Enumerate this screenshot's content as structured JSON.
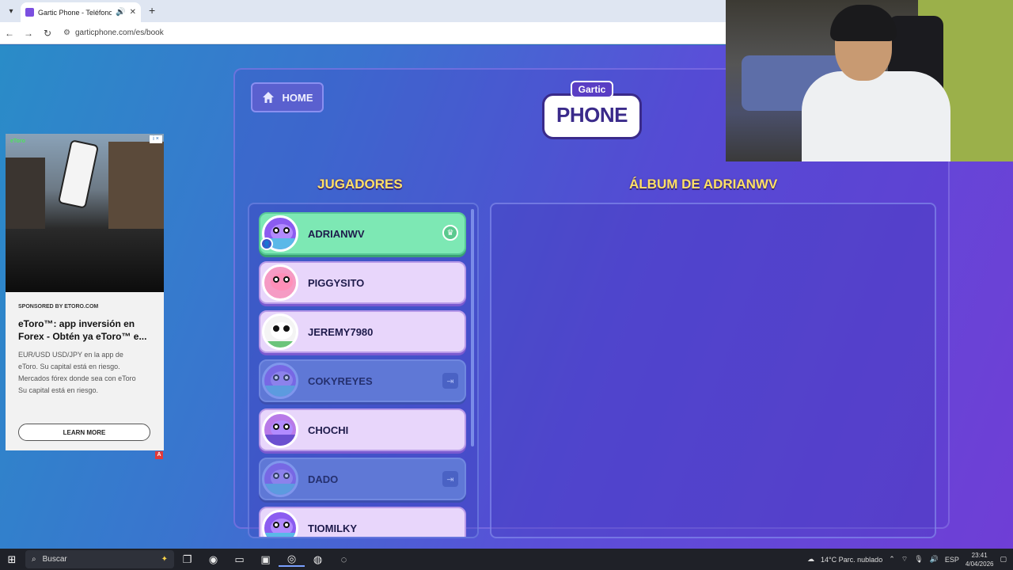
{
  "browser": {
    "tab_title": "Gartic Phone - Teléfono De",
    "url": "garticphone.com/es/book",
    "new_tab_symbol": "+"
  },
  "ad": {
    "brand": "eToro",
    "adchoices": "i ×",
    "sponsor": "SPONSORED BY ETORO.COM",
    "headline": "eToro™: app inversión en Forex - Obtén ya eToro™ e...",
    "body": "EUR/USD USD/JPY en la app de eToro. Su capital está en riesgo. Mercados fórex donde sea con eToro Su capital está en riesgo.",
    "cta": "LEARN MORE",
    "mark": "A"
  },
  "game": {
    "home_label": "HOME",
    "logo_top": "Gartic",
    "logo_bottom": "PHONE",
    "players_heading": "JUGADORES",
    "album_heading": "ÁLBUM DE ADRIANWV",
    "players": [
      {
        "name": "ADRIANWV",
        "state": "active",
        "avatar": "purple-bird"
      },
      {
        "name": "PIGGYSITO",
        "state": "normal",
        "avatar": "pig"
      },
      {
        "name": "JEREMY7980",
        "state": "normal",
        "avatar": "panda"
      },
      {
        "name": "COKYREYES",
        "state": "offline",
        "avatar": "purple-bird"
      },
      {
        "name": "CHOCHI",
        "state": "normal",
        "avatar": "bow"
      },
      {
        "name": "DADO",
        "state": "offline",
        "avatar": "purple-bird"
      },
      {
        "name": "TIOMILKY",
        "state": "normal",
        "avatar": "purple-bird"
      }
    ]
  },
  "taskbar": {
    "search_placeholder": "Buscar",
    "weather": "14°C Parc. nublado",
    "language": "ESP",
    "time": "23:41",
    "date": "4/04/2026"
  }
}
